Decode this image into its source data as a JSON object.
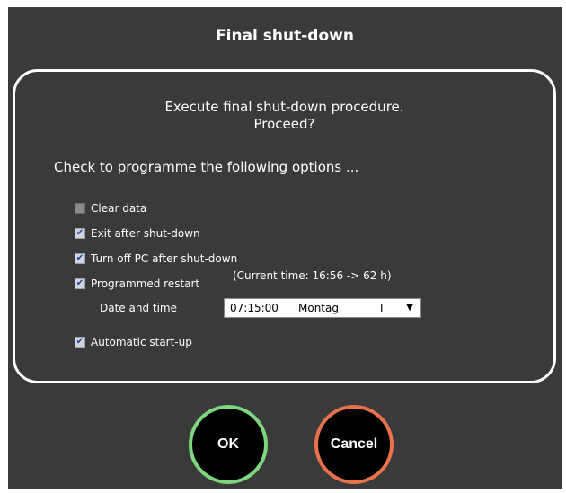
{
  "dialog": {
    "title": "Final shut-down",
    "message_line1": "Execute final shut-down procedure.",
    "message_line2": "Proceed?",
    "instruction": "Check to programme the following options ...",
    "options": [
      {
        "label": "Clear data",
        "checked": false
      },
      {
        "label": "Exit after shut-down",
        "checked": true
      },
      {
        "label": "Turn off PC after shut-down",
        "checked": true
      },
      {
        "label": "Programmed restart",
        "checked": true
      },
      {
        "label": "Automatic start-up",
        "checked": true
      }
    ],
    "current_time_text": "(Current time: 16:56 -> 62 h)",
    "date_time_label": "Date and time",
    "date_time_value": {
      "time": "07:15:00",
      "day": "Montag",
      "extra": "I"
    },
    "buttons": {
      "ok": "OK",
      "cancel": "Cancel"
    },
    "colors": {
      "ok_ring": "#7ed67e",
      "cancel_ring": "#e8734a",
      "background": "#3a3a3a"
    }
  }
}
